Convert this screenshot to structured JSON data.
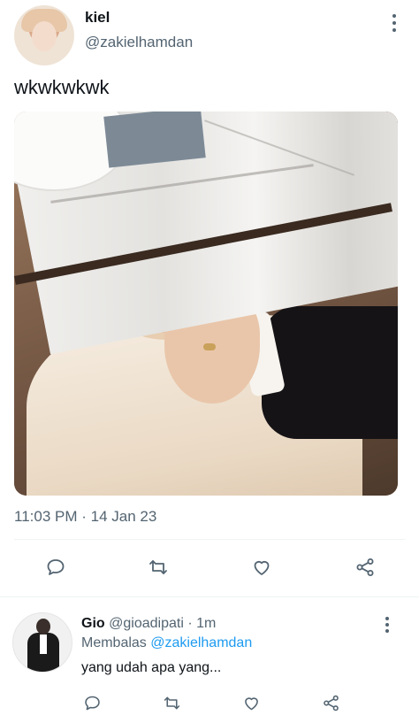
{
  "tweet": {
    "author_name": "kiel",
    "author_handle": "@zakielhamdan",
    "text": "wkwkwkwk",
    "timestamp": "11:03 PM · 14 Jan 23",
    "more_icon": "more-vertical-icon"
  },
  "actions": [
    "reply-icon",
    "retweet-icon",
    "like-icon",
    "share-icon"
  ],
  "reply": {
    "author_name": "Gio",
    "author_handle": "@gioadipati",
    "separator": " · ",
    "age": "1m",
    "reply_prefix": "Membalas ",
    "reply_to": "@zakielhamdan",
    "text": "yang udah apa yang..."
  },
  "colors": {
    "text": "#0f1419",
    "secondary": "#536471",
    "link": "#1d9bf0",
    "divider": "#eff3f4"
  }
}
